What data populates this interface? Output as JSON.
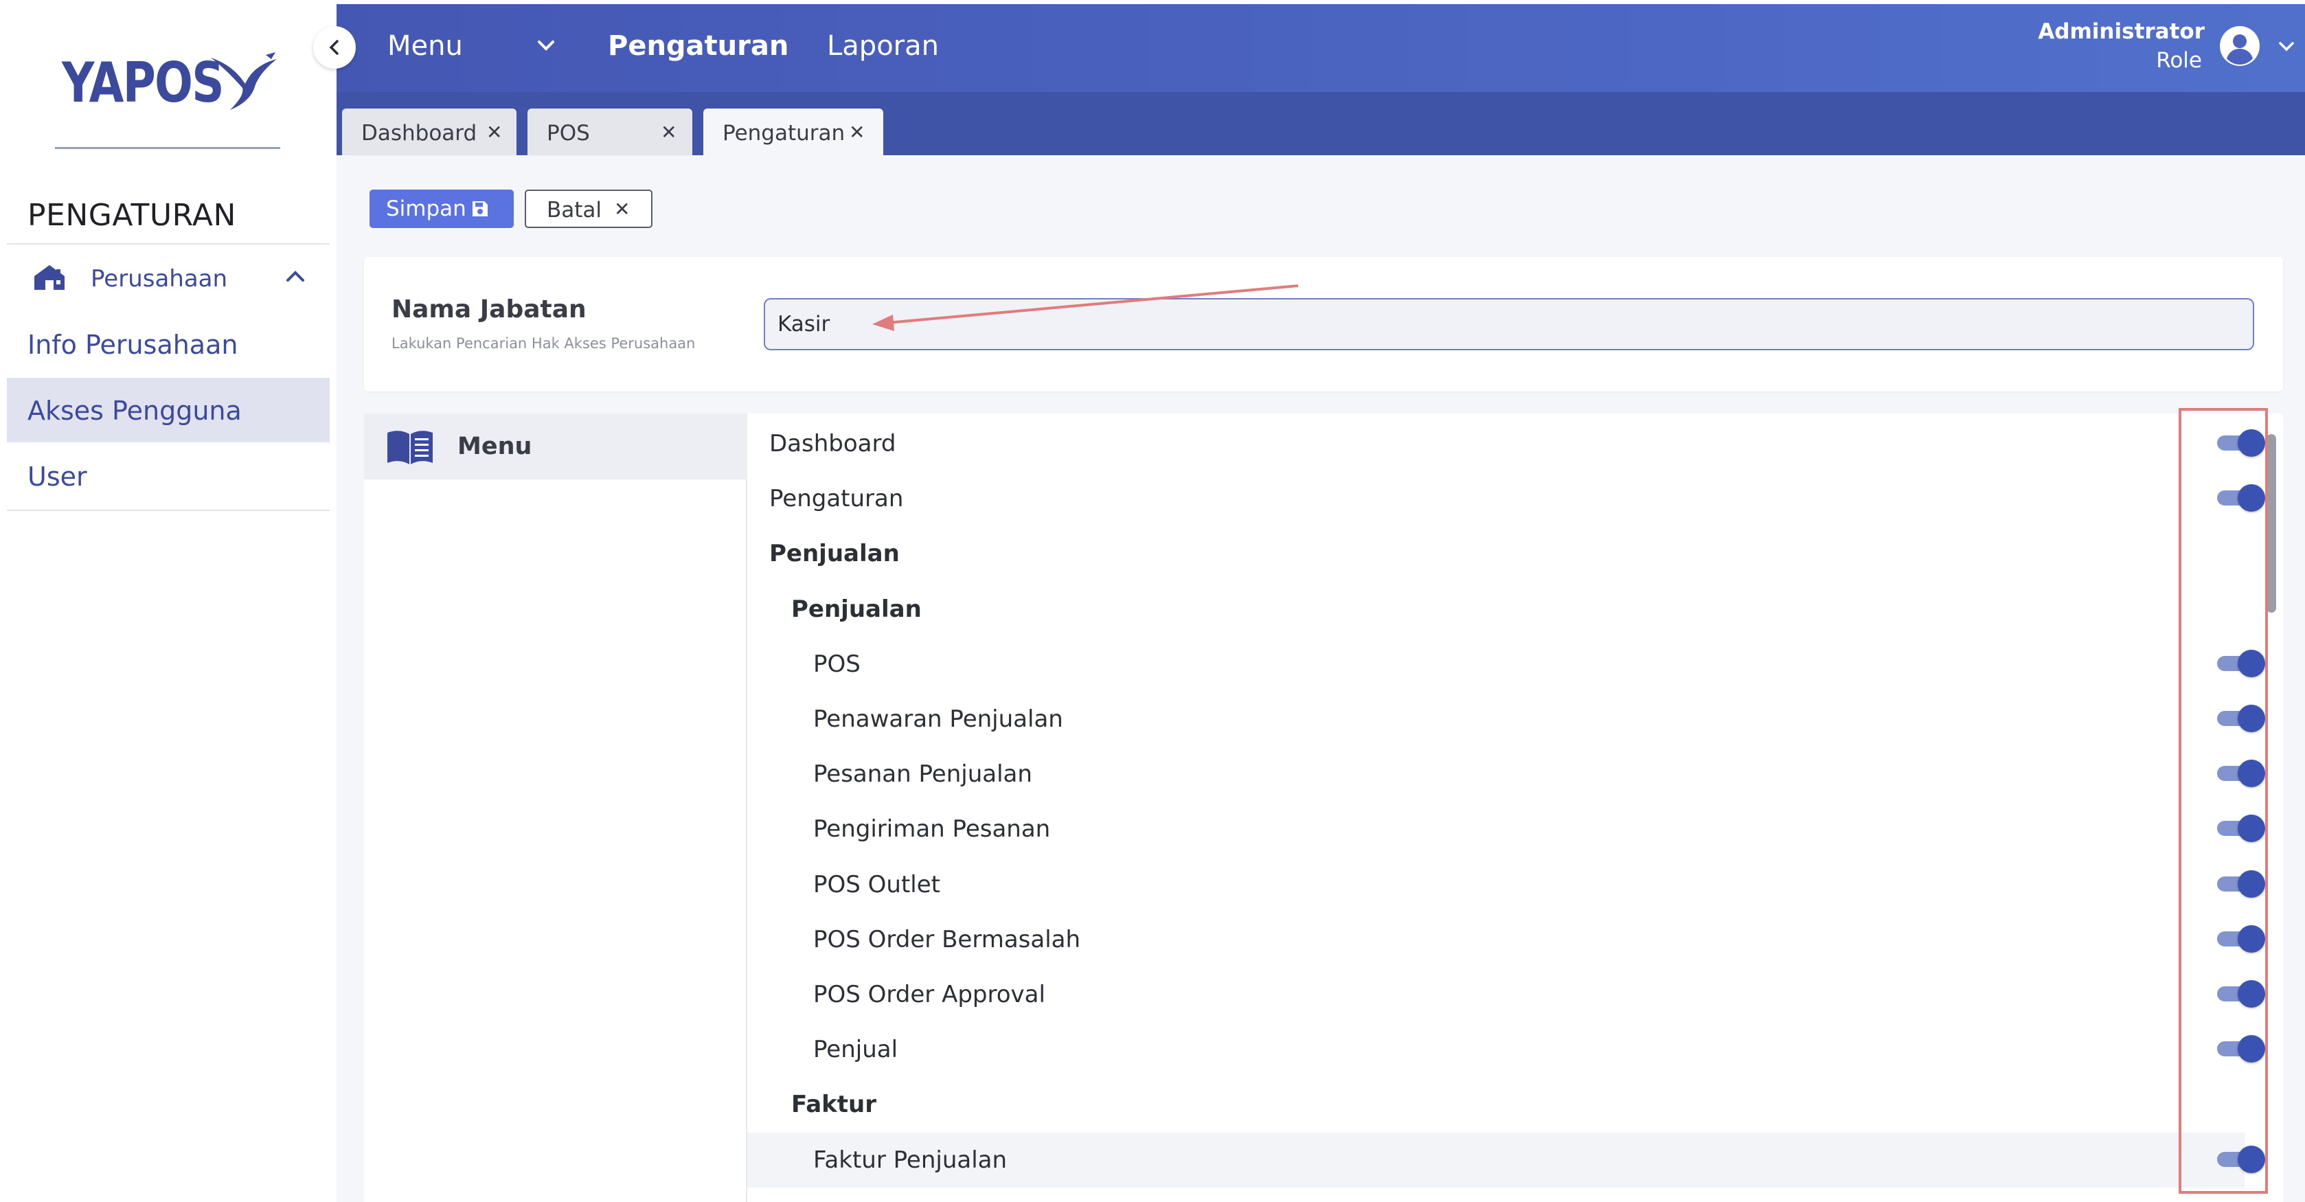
{
  "brand": {
    "logo_text": "YAPOS"
  },
  "sidebar": {
    "section_title": "PENGATURAN",
    "parent": {
      "label": "Perusahaan",
      "icon": "home-icon",
      "expanded": true
    },
    "items": [
      {
        "label": "Info Perusahaan",
        "active": false
      },
      {
        "label": "Akses Pengguna",
        "active": true
      },
      {
        "label": "User",
        "active": false
      }
    ]
  },
  "header": {
    "menu_label": "Menu",
    "nav": [
      "Pengaturan",
      "Laporan"
    ],
    "user": {
      "name": "Administrator",
      "role": "Role"
    }
  },
  "tabs": [
    {
      "label": "Dashboard",
      "active": false
    },
    {
      "label": "POS",
      "active": false
    },
    {
      "label": "Pengaturan",
      "active": true
    }
  ],
  "toolbar": {
    "save_label": "Simpan",
    "cancel_label": "Batal"
  },
  "form": {
    "label": "Nama Jabatan",
    "hint": "Lakukan Pencarian Hak Akses Perusahaan",
    "value": "Kasir"
  },
  "menu_panel": {
    "title": "Menu"
  },
  "access_rows": [
    {
      "label": "Dashboard",
      "level": 0,
      "bold": false,
      "toggle": true,
      "on": true
    },
    {
      "label": "Pengaturan",
      "level": 0,
      "bold": false,
      "toggle": true,
      "on": true
    },
    {
      "label": "Penjualan",
      "level": 0,
      "bold": true,
      "toggle": false
    },
    {
      "label": "Penjualan",
      "level": 1,
      "bold": true,
      "toggle": false
    },
    {
      "label": "POS",
      "level": 2,
      "bold": false,
      "toggle": true,
      "on": true
    },
    {
      "label": "Penawaran Penjualan",
      "level": 2,
      "bold": false,
      "toggle": true,
      "on": true
    },
    {
      "label": "Pesanan Penjualan",
      "level": 2,
      "bold": false,
      "toggle": true,
      "on": true
    },
    {
      "label": "Pengiriman Pesanan",
      "level": 2,
      "bold": false,
      "toggle": true,
      "on": true
    },
    {
      "label": "POS Outlet",
      "level": 2,
      "bold": false,
      "toggle": true,
      "on": true
    },
    {
      "label": "POS Order Bermasalah",
      "level": 2,
      "bold": false,
      "toggle": true,
      "on": true
    },
    {
      "label": "POS Order Approval",
      "level": 2,
      "bold": false,
      "toggle": true,
      "on": true
    },
    {
      "label": "Penjual",
      "level": 2,
      "bold": false,
      "toggle": true,
      "on": true
    },
    {
      "label": "Faktur",
      "level": 1,
      "bold": true,
      "toggle": false
    },
    {
      "label": "Faktur Penjualan",
      "level": 2,
      "bold": false,
      "toggle": true,
      "on": true,
      "hover": true
    }
  ],
  "colors": {
    "brand_blue": "#3b4a9c",
    "header_start": "#4457b3",
    "header_end": "#5170cc",
    "primary_button": "#5b73e0",
    "toggle_on": "#3a52b2",
    "annotation_red": "#e07c7c"
  }
}
